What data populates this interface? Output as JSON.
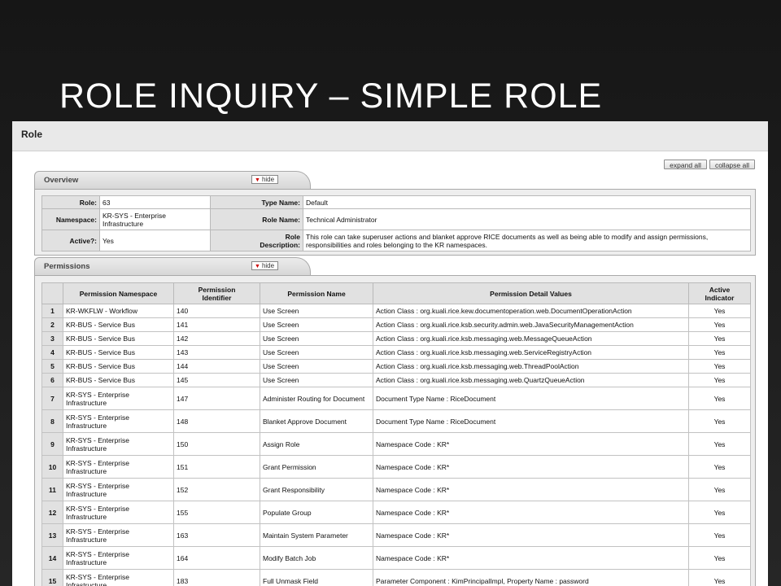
{
  "slide": {
    "title": "ROLE INQUIRY – SIMPLE ROLE"
  },
  "page": {
    "title": "Role",
    "expand_all": "expand all",
    "collapse_all": "collapse all",
    "hide_label": "hide"
  },
  "overview": {
    "tab_label": "Overview",
    "role_label": "Role:",
    "role_value": "63",
    "type_name_label": "Type Name:",
    "type_name_value": "Default",
    "namespace_label": "Namespace:",
    "namespace_value": "KR-SYS - Enterprise Infrastructure",
    "role_name_label": "Role Name:",
    "role_name_value": "Technical Administrator",
    "active_label": "Active?:",
    "active_value": "Yes",
    "role_desc_label_1": "Role",
    "role_desc_label_2": "Description:",
    "role_desc_value": "This role can take superuser actions and blanket approve RICE documents as well as being able to modify and assign permissions, responsibilities and roles belonging to the KR namespaces."
  },
  "permissions": {
    "tab_label": "Permissions",
    "headers": {
      "namespace": "Permission Namespace",
      "identifier_1": "Permission",
      "identifier_2": "Identifier",
      "name": "Permission Name",
      "detail": "Permission Detail Values",
      "active_1": "Active",
      "active_2": "Indicator"
    },
    "rows": [
      {
        "num": "1",
        "ns": "KR-WKFLW - Workflow",
        "id": "140",
        "name": "Use Screen",
        "detail": "Action Class : org.kuali.rice.kew.documentoperation.web.DocumentOperationAction",
        "active": "Yes"
      },
      {
        "num": "2",
        "ns": "KR-BUS - Service Bus",
        "id": "141",
        "name": "Use Screen",
        "detail": "Action Class : org.kuali.rice.ksb.security.admin.web.JavaSecurityManagementAction",
        "active": "Yes"
      },
      {
        "num": "3",
        "ns": "KR-BUS - Service Bus",
        "id": "142",
        "name": "Use Screen",
        "detail": "Action Class : org.kuali.rice.ksb.messaging.web.MessageQueueAction",
        "active": "Yes"
      },
      {
        "num": "4",
        "ns": "KR-BUS - Service Bus",
        "id": "143",
        "name": "Use Screen",
        "detail": "Action Class : org.kuali.rice.ksb.messaging.web.ServiceRegistryAction",
        "active": "Yes"
      },
      {
        "num": "5",
        "ns": "KR-BUS - Service Bus",
        "id": "144",
        "name": "Use Screen",
        "detail": "Action Class : org.kuali.rice.ksb.messaging.web.ThreadPoolAction",
        "active": "Yes"
      },
      {
        "num": "6",
        "ns": "KR-BUS - Service Bus",
        "id": "145",
        "name": "Use Screen",
        "detail": "Action Class : org.kuali.rice.ksb.messaging.web.QuartzQueueAction",
        "active": "Yes"
      },
      {
        "num": "7",
        "ns": "KR-SYS - Enterprise Infrastructure",
        "id": "147",
        "name": "Administer Routing for Document",
        "detail": "Document Type Name : RiceDocument",
        "active": "Yes"
      },
      {
        "num": "8",
        "ns": "KR-SYS - Enterprise Infrastructure",
        "id": "148",
        "name": "Blanket Approve Document",
        "detail": "Document Type Name : RiceDocument",
        "active": "Yes"
      },
      {
        "num": "9",
        "ns": "KR-SYS - Enterprise Infrastructure",
        "id": "150",
        "name": "Assign Role",
        "detail": "Namespace Code : KR*",
        "active": "Yes"
      },
      {
        "num": "10",
        "ns": "KR-SYS - Enterprise Infrastructure",
        "id": "151",
        "name": "Grant Permission",
        "detail": "Namespace Code : KR*",
        "active": "Yes"
      },
      {
        "num": "11",
        "ns": "KR-SYS - Enterprise Infrastructure",
        "id": "152",
        "name": "Grant Responsibility",
        "detail": "Namespace Code : KR*",
        "active": "Yes"
      },
      {
        "num": "12",
        "ns": "KR-SYS - Enterprise Infrastructure",
        "id": "155",
        "name": "Populate Group",
        "detail": "Namespace Code : KR*",
        "active": "Yes"
      },
      {
        "num": "13",
        "ns": "KR-SYS - Enterprise Infrastructure",
        "id": "163",
        "name": "Maintain System Parameter",
        "detail": "Namespace Code : KR*",
        "active": "Yes"
      },
      {
        "num": "14",
        "ns": "KR-SYS - Enterprise Infrastructure",
        "id": "164",
        "name": "Modify Batch Job",
        "detail": "Namespace Code : KR*",
        "active": "Yes"
      },
      {
        "num": "15",
        "ns": "KR-SYS - Enterprise Infrastructure",
        "id": "183",
        "name": "Full Unmask Field",
        "detail": "Parameter Component : KimPrincipalImpl, Property Name : password",
        "active": "Yes"
      }
    ]
  }
}
